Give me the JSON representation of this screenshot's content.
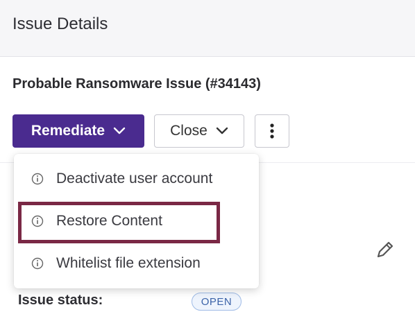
{
  "panel": {
    "title": "Issue Details"
  },
  "issue": {
    "title": "Probable Ransomware Issue (#34143)",
    "status_label": "Issue status:",
    "status_value": "OPEN"
  },
  "actions": {
    "remediate_label": "Remediate",
    "close_label": "Close",
    "more_icon": "vertical-ellipsis-icon"
  },
  "remediate_menu": {
    "items": [
      {
        "label": "Deactivate user account",
        "icon": "info-icon"
      },
      {
        "label": "Restore Content",
        "icon": "info-icon",
        "highlighted": true
      },
      {
        "label": "Whitelist file extension",
        "icon": "info-icon"
      }
    ]
  },
  "colors": {
    "primary": "#4a2b8f",
    "highlight": "#7a2845",
    "status_badge": "#3b63a8"
  },
  "icons": {
    "edit": "pencil-icon"
  }
}
